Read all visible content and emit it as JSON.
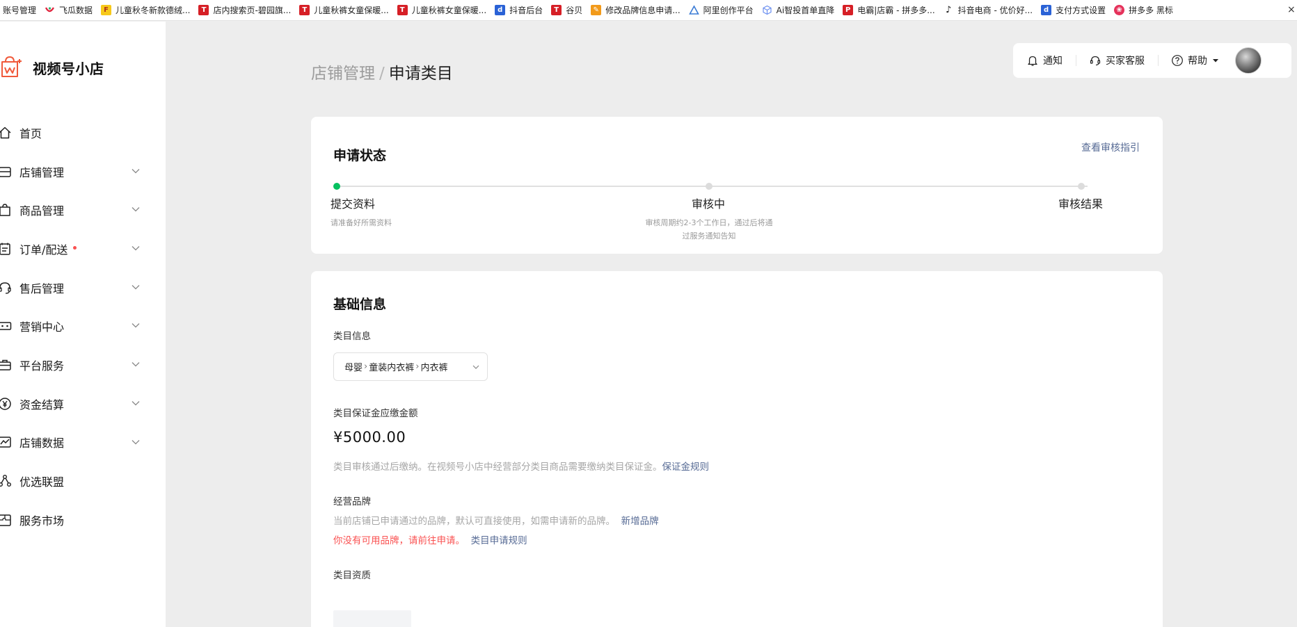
{
  "bookmarks": [
    {
      "label": "账号管理",
      "icon": "none"
    },
    {
      "label": "飞瓜数据",
      "icon": "feigua-icon"
    },
    {
      "label": "儿童秋冬新款德绒...",
      "icon": "yellow-f-icon"
    },
    {
      "label": "店内搜索页-碧园旗...",
      "icon": "tmall-icon"
    },
    {
      "label": "儿童秋裤女童保暖...",
      "icon": "tmall-icon"
    },
    {
      "label": "儿童秋裤女童保暖...",
      "icon": "tmall-icon"
    },
    {
      "label": "抖音后台",
      "icon": "blue-d-icon"
    },
    {
      "label": "谷贝",
      "icon": "tmall-icon"
    },
    {
      "label": "修改品牌信息申请...",
      "icon": "orange-icon"
    },
    {
      "label": "阿里创作平台",
      "icon": "triangle-icon"
    },
    {
      "label": "Ai智投首单直降",
      "icon": "cube-icon"
    },
    {
      "label": "电霸|店霸 - 拼多多...",
      "icon": "red-p-icon"
    },
    {
      "label": "抖音电商 - 优价好...",
      "icon": "tiktok-icon"
    },
    {
      "label": "支付方式设置",
      "icon": "blue-d-icon"
    },
    {
      "label": "拼多多 黑标",
      "icon": "pinduoduo-icon"
    }
  ],
  "bookmark_close": "×",
  "sidebar": {
    "brand": "视频号小店",
    "items": [
      {
        "label": "首页",
        "icon": "home-icon",
        "expandable": false,
        "dot": false
      },
      {
        "label": "店铺管理",
        "icon": "store-icon",
        "expandable": true,
        "dot": false
      },
      {
        "label": "商品管理",
        "icon": "bag-icon",
        "expandable": true,
        "dot": false
      },
      {
        "label": "订单/配送",
        "icon": "order-icon",
        "expandable": true,
        "dot": true
      },
      {
        "label": "售后管理",
        "icon": "headset-icon",
        "expandable": true,
        "dot": false
      },
      {
        "label": "营销中心",
        "icon": "ticket-icon",
        "expandable": true,
        "dot": false
      },
      {
        "label": "平台服务",
        "icon": "briefcase-icon",
        "expandable": true,
        "dot": false
      },
      {
        "label": "资金结算",
        "icon": "yen-icon",
        "expandable": true,
        "dot": false
      },
      {
        "label": "店铺数据",
        "icon": "chart-icon",
        "expandable": true,
        "dot": false
      },
      {
        "label": "优选联盟",
        "icon": "network-icon",
        "expandable": false,
        "dot": false
      },
      {
        "label": "服务市场",
        "icon": "puzzle-icon",
        "expandable": false,
        "dot": false
      }
    ]
  },
  "breadcrumb": {
    "parent": "店铺管理",
    "separator": "/",
    "current": "申请类目"
  },
  "topbar": {
    "notify": "通知",
    "service": "买家客服",
    "help": "帮助"
  },
  "status_card": {
    "title": "申请状态",
    "guide_link": "查看审核指引",
    "steps": [
      {
        "label": "提交资料",
        "desc": [
          "请准备好所需资料"
        ],
        "active": true
      },
      {
        "label": "审核中",
        "desc": [
          "审核周期约2-3个工作日，通过后将通",
          "过服务通知告知"
        ],
        "active": false
      },
      {
        "label": "审核结果",
        "desc": [],
        "active": false
      }
    ]
  },
  "basic_card": {
    "title": "基础信息",
    "category_label": "类目信息",
    "category_path": [
      "母婴",
      "童装内衣裤",
      "内衣裤"
    ],
    "deposit_label": "类目保证金应缴金额",
    "deposit_amount": "¥5000.00",
    "deposit_hint": "类目审核通过后缴纳。在视频号小店中经营部分类目商品需要缴纳类目保证金。",
    "deposit_rule_link": "保证金规则",
    "brand_label": "经营品牌",
    "brand_hint": "当前店铺已申请通过的品牌，默认可直接使用，如需申请新的品牌。",
    "add_brand_link": "新增品牌",
    "no_brand_warning": "你没有可用品牌，请前往申请。",
    "brand_rule_link": "类目申请规则",
    "qualification_label": "类目资质"
  },
  "colors": {
    "accent_green": "#07c160",
    "link": "#576b95",
    "warning": "#fa5151",
    "page_bg": "#ededed"
  }
}
